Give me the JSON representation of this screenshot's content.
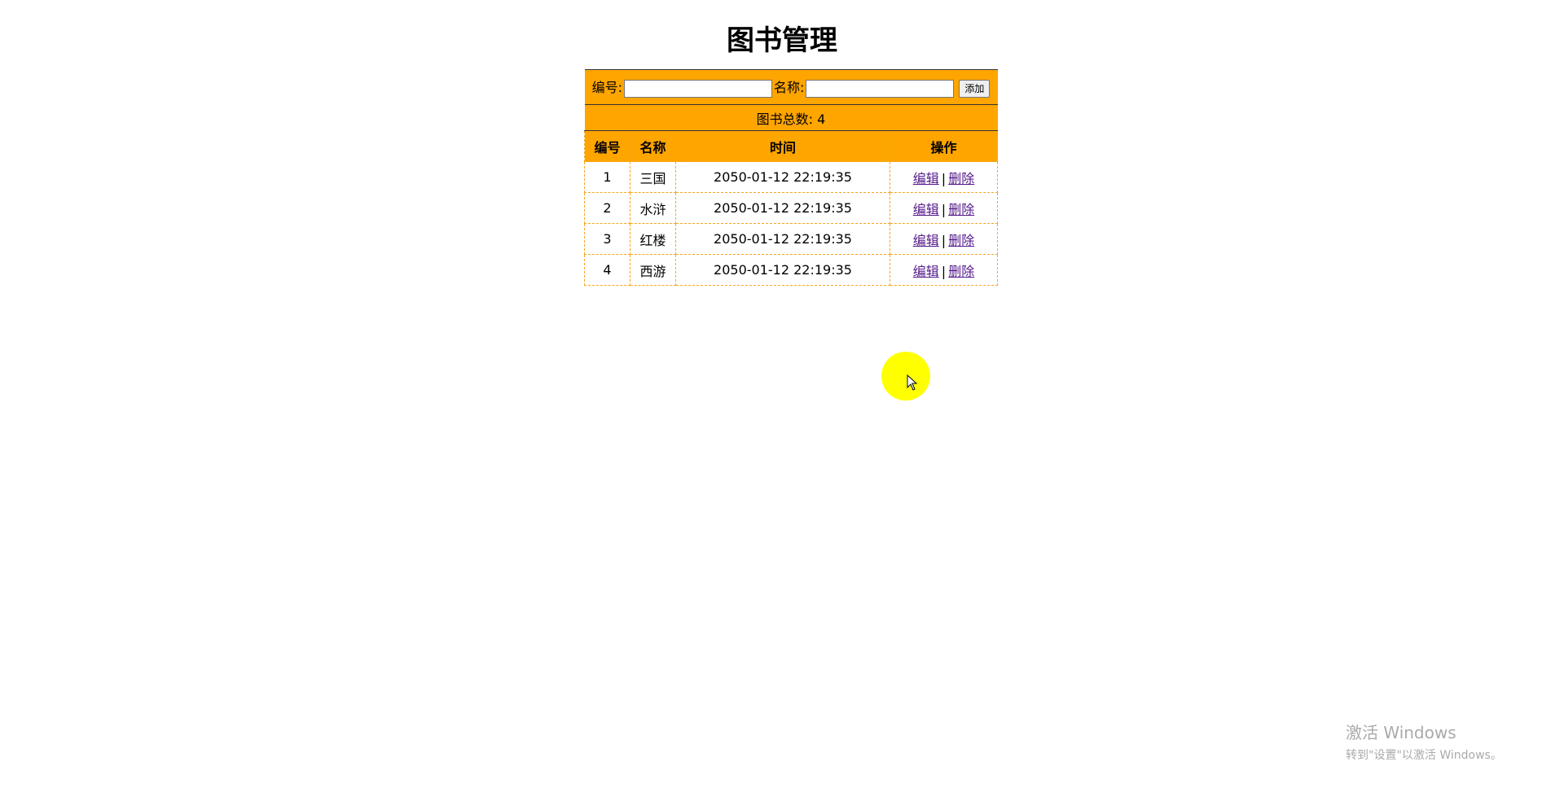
{
  "page": {
    "title": "图书管理"
  },
  "form": {
    "id_label": "编号:",
    "id_value": "",
    "name_label": "名称:",
    "name_value": "",
    "add_label": "添加"
  },
  "summary": {
    "text": "图书总数: 4"
  },
  "table": {
    "headers": [
      "编号",
      "名称",
      "时间",
      "操作"
    ],
    "rows": [
      {
        "id": "1",
        "name": "三国",
        "time": "2050-01-12 22:19:35",
        "edit": "编辑",
        "sep": "|",
        "delete": "删除"
      },
      {
        "id": "2",
        "name": "水浒",
        "time": "2050-01-12 22:19:35",
        "edit": "编辑",
        "sep": "|",
        "delete": "删除"
      },
      {
        "id": "3",
        "name": "红楼",
        "time": "2050-01-12 22:19:35",
        "edit": "编辑",
        "sep": "|",
        "delete": "删除"
      },
      {
        "id": "4",
        "name": "西游",
        "time": "2050-01-12 22:19:35",
        "edit": "编辑",
        "sep": "|",
        "delete": "删除"
      }
    ]
  },
  "watermark": {
    "title": "激活 Windows",
    "subtitle": "转到\"设置\"以激活 Windows。"
  },
  "colors": {
    "header_bg": "#ffa500",
    "border": "#f5a623",
    "link": "#551a8b",
    "cursor_highlight": "#ffff00"
  }
}
